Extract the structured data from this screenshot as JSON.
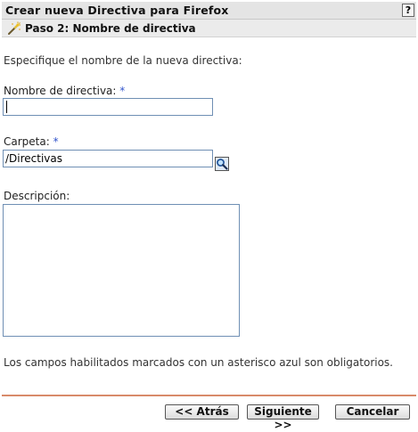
{
  "header": {
    "title": "Crear nueva Directiva para Firefox",
    "help_label": "?",
    "step": "Paso 2: Nombre de directiva"
  },
  "form": {
    "intro": "Especifique el nombre de la nueva directiva:",
    "name_label": "Nombre de directiva:",
    "name_required": "*",
    "name_value": "",
    "folder_label": "Carpeta:",
    "folder_required": "*",
    "folder_value": "/Directivas",
    "description_label": "Descripción:",
    "description_value": "",
    "footnote": "Los campos habilitados marcados con un asterisco azul son obligatorios."
  },
  "icons": {
    "step": "wand-icon",
    "folder_browse": "magnifier-icon"
  },
  "colors": {
    "required_asterisk": "#3355cc",
    "divider": "#d88a6a"
  },
  "buttons": {
    "back": "<< Atrás",
    "next": "Siguiente >>",
    "cancel": "Cancelar"
  }
}
